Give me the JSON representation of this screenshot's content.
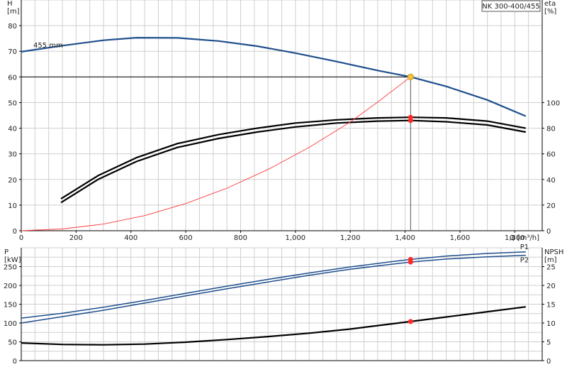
{
  "product_label": "NK 300-400/455",
  "colors": {
    "head": "#1f4e8c",
    "efficiency": "#000000",
    "system_curve": "#ff3b3b",
    "power": "#1f4e8c",
    "npsh": "#000000",
    "duty_marker_head": "#f5c242",
    "duty_marker": "#ff2a2a",
    "grid": "#cfcfcf"
  },
  "chart_data": [
    {
      "type": "line",
      "title": "",
      "xlabel": "Q [m³/h]",
      "ylabel_left": "H\n[m]",
      "ylabel_right": "eta\n[%]",
      "xlim": [
        0,
        1900
      ],
      "ylim_left": [
        0,
        90
      ],
      "ylim_right": [
        0,
        180
      ],
      "x_ticks": [
        "0",
        "200",
        "400",
        "600",
        "800",
        "1,000",
        "1,200",
        "1,400",
        "1,600",
        "1,800"
      ],
      "x_tick_values": [
        0,
        200,
        400,
        600,
        800,
        1000,
        1200,
        1400,
        1600,
        1800
      ],
      "y_ticks_left": [
        0,
        10,
        20,
        30,
        40,
        50,
        60,
        70,
        80
      ],
      "y_ticks_right": [
        0,
        20,
        40,
        60,
        80,
        100
      ],
      "grid": true,
      "annotation_impeller": "455 mm",
      "series": [
        {
          "role": "head",
          "axis": "left",
          "x": [
            0,
            150,
            300,
            420,
            570,
            720,
            860,
            1000,
            1150,
            1300,
            1420,
            1550,
            1700,
            1840
          ],
          "y": [
            69.8,
            72.2,
            74.3,
            75.3,
            75.2,
            74.0,
            72.0,
            69.3,
            66.0,
            62.5,
            60.0,
            56.3,
            51.0,
            44.7
          ]
        },
        {
          "role": "efficiency-upper",
          "axis": "right",
          "x": [
            145,
            280,
            420,
            570,
            720,
            860,
            1000,
            1150,
            1300,
            1420,
            1550,
            1700,
            1840
          ],
          "y": [
            25,
            43,
            57,
            68,
            75,
            80,
            84,
            86.5,
            88,
            88.5,
            88,
            85.5,
            80
          ]
        },
        {
          "role": "efficiency-lower",
          "axis": "right",
          "x": [
            145,
            280,
            420,
            570,
            720,
            860,
            1000,
            1150,
            1300,
            1420,
            1550,
            1700,
            1840
          ],
          "y": [
            22,
            40,
            54,
            65,
            72,
            77,
            81,
            84,
            85.5,
            86,
            85,
            82.5,
            77
          ]
        },
        {
          "role": "system-curve",
          "axis": "left",
          "x": [
            0,
            150,
            300,
            450,
            600,
            750,
            900,
            1050,
            1200,
            1300,
            1420
          ],
          "y": [
            0,
            0.7,
            2.6,
            5.9,
            10.6,
            16.6,
            23.9,
            32.5,
            42.4,
            50.2,
            60.0
          ]
        }
      ],
      "duty_point": {
        "q": 1420,
        "head": 60,
        "eta_values": [
          88.5,
          86
        ]
      }
    },
    {
      "type": "line",
      "title": "",
      "xlabel": "",
      "ylabel_left": "P\n[kW]",
      "ylabel_right": "NPSH\n[m]",
      "xlim": [
        0,
        1900
      ],
      "ylim_left": [
        0,
        300
      ],
      "ylim_right": [
        0,
        30
      ],
      "y_ticks_left": [
        0,
        50,
        100,
        150,
        200,
        250
      ],
      "y_ticks_right": [
        0,
        5,
        10,
        15,
        20,
        25
      ],
      "grid": true,
      "series": [
        {
          "name": "P1",
          "role": "power-p1",
          "axis": "left",
          "x": [
            0,
            150,
            300,
            450,
            600,
            750,
            900,
            1050,
            1200,
            1350,
            1420,
            1550,
            1700,
            1840
          ],
          "y": [
            113,
            126,
            142,
            160,
            179,
            198,
            216,
            233,
            249,
            263,
            269,
            278,
            285,
            289
          ]
        },
        {
          "name": "P2",
          "role": "power-p2",
          "axis": "left",
          "x": [
            0,
            150,
            300,
            450,
            600,
            750,
            900,
            1050,
            1200,
            1350,
            1420,
            1550,
            1700,
            1840
          ],
          "y": [
            100,
            117,
            134,
            153,
            172,
            191,
            209,
            227,
            243,
            256,
            262,
            270,
            276,
            280
          ]
        },
        {
          "role": "npsh",
          "axis": "right",
          "x": [
            0,
            150,
            300,
            450,
            600,
            750,
            900,
            1050,
            1200,
            1420,
            1550,
            1700,
            1840
          ],
          "y": [
            4.7,
            4.3,
            4.2,
            4.4,
            4.9,
            5.6,
            6.4,
            7.3,
            8.4,
            10.4,
            11.6,
            13.0,
            14.3
          ]
        }
      ],
      "duty_point": {
        "q": 1420,
        "p1": 269,
        "p2": 262,
        "npsh": 10.4
      }
    }
  ]
}
